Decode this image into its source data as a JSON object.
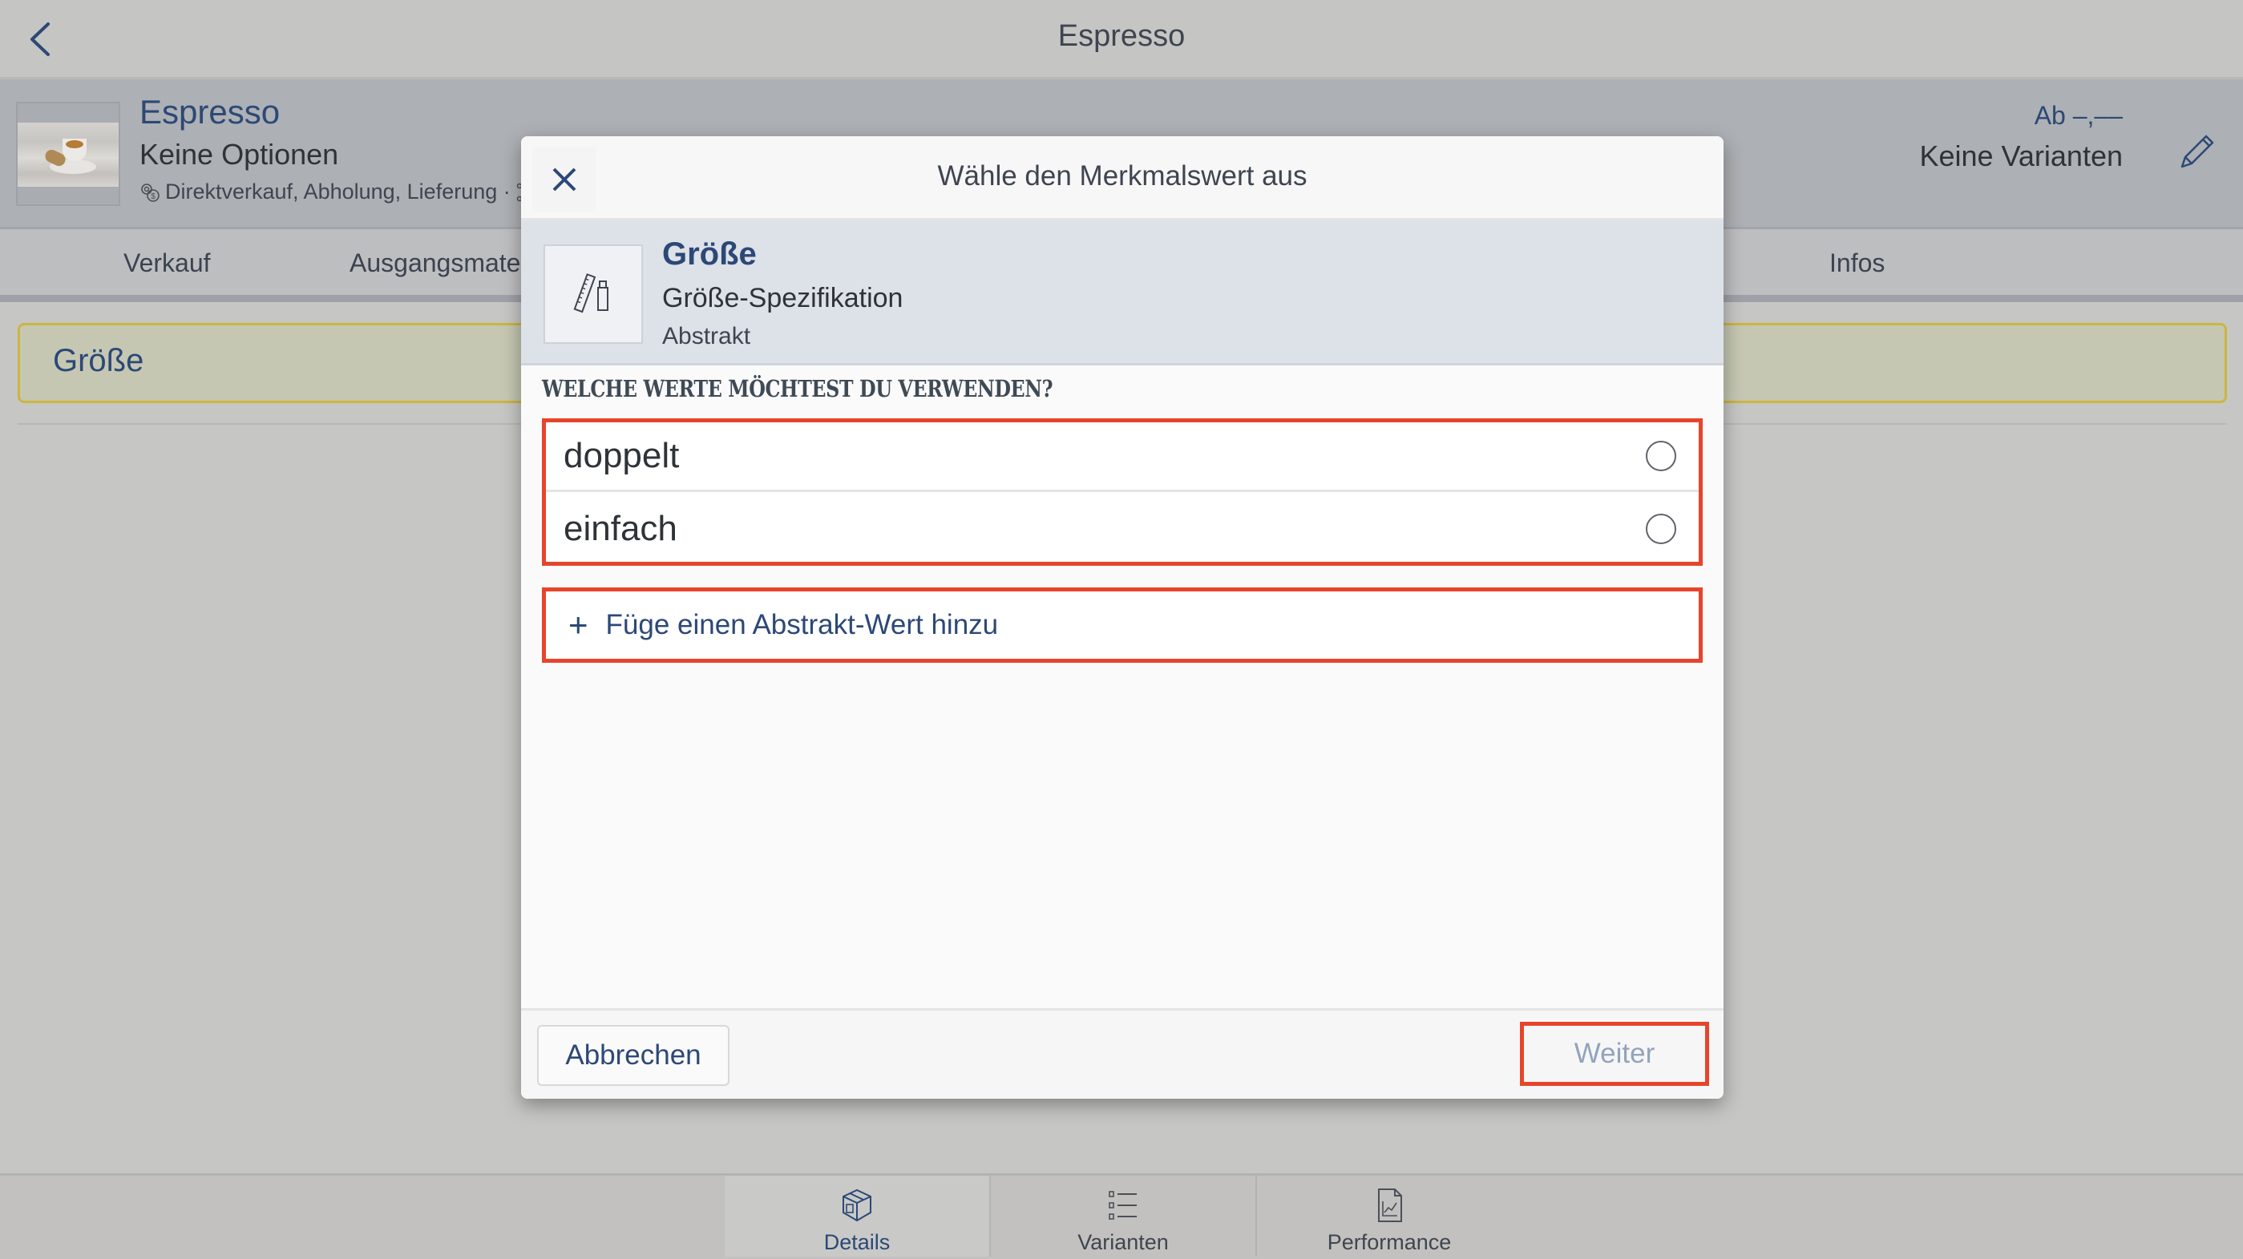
{
  "nav": {
    "title": "Espresso",
    "back_icon": "chevron-left-icon"
  },
  "product": {
    "name": "Espresso",
    "options": "Keine Optionen",
    "channels": "Direktverkauf, Abholung, Lieferung ·",
    "channels_icon": "sales-channel-gear-icon",
    "network_icon": "network-icon",
    "price": "Ab –,––",
    "variants": "Keine Varianten",
    "edit_icon": "pencil-icon"
  },
  "tabs": [
    {
      "label": "Verkauf"
    },
    {
      "label": "Ausgangsmaterial"
    },
    {
      "label": "Infos"
    }
  ],
  "content": {
    "section_label": "Größe"
  },
  "bottom_tabs": [
    {
      "label": "Details",
      "icon": "box-icon",
      "active": true
    },
    {
      "label": "Varianten",
      "icon": "list-icon",
      "active": false
    },
    {
      "label": "Performance",
      "icon": "chart-document-icon",
      "active": false
    }
  ],
  "modal": {
    "title": "Wähle den Merkmalswert aus",
    "close_icon": "close-icon",
    "attribute": {
      "name": "Größe",
      "spec": "Größe-Spezifikation",
      "type": "Abstrakt",
      "icon": "ruler-bottle-icon"
    },
    "question": "WELCHE WERTE MÖCHTEST DU VERWENDEN?",
    "options": [
      {
        "label": "doppelt",
        "selected": false
      },
      {
        "label": "einfach",
        "selected": false
      }
    ],
    "add_value": {
      "plus": "+",
      "label": "Füge einen Abstrakt-Wert hinzu"
    },
    "cancel_label": "Abbrechen",
    "next_label": "Weiter"
  },
  "colors": {
    "accent": "#2c4876",
    "highlight": "#e6452b",
    "section_border": "#ccb63e"
  }
}
